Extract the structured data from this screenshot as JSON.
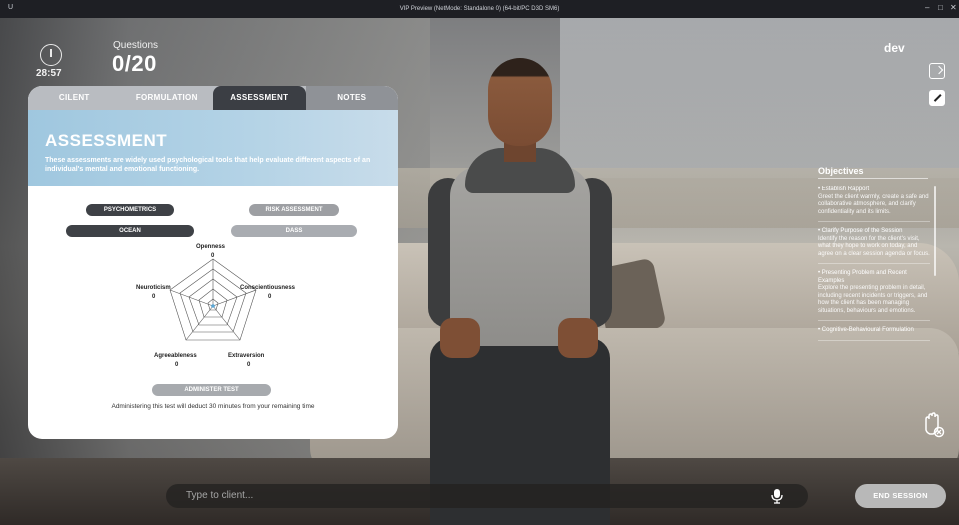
{
  "window": {
    "title": "VIP Preview (NetMode: Standalone 0) (64-bit/PC D3D SM6)",
    "app_icon": "U",
    "controls": [
      "–",
      "□",
      "✕"
    ]
  },
  "hud": {
    "timer": "28:57",
    "questions_label": "Questions",
    "questions_count": "0/20",
    "user": "dev"
  },
  "panel": {
    "tabs": [
      "CILENT",
      "FORMULATION",
      "ASSESSMENT",
      "NOTES"
    ],
    "active_tab": "ASSESSMENT",
    "title": "ASSESSMENT",
    "description": "These assessments are widely used psychological tools that help evaluate different aspects of an individual's mental and emotional functioning.",
    "categories": [
      "PSYCHOMETRICS",
      "RISK ASSESSMENT"
    ],
    "tests": [
      "OCEAN",
      "DASS"
    ],
    "radar": {
      "traits": [
        {
          "name": "Openness",
          "value": "0"
        },
        {
          "name": "Conscientiousness",
          "value": "0"
        },
        {
          "name": "Extraversion",
          "value": "0"
        },
        {
          "name": "Agreeableness",
          "value": "0"
        },
        {
          "name": "Neuroticism",
          "value": "0"
        }
      ]
    },
    "administer_button": "ADMINISTER TEST",
    "administer_note": "Administering this test will deduct 30 minutes from your remaining time"
  },
  "objectives": {
    "title": "Objectives",
    "items": [
      {
        "head": "• Establish Rapport",
        "body": "Greet the client warmly, create a safe and collaborative atmosphere, and clarify confidentiality and its limits."
      },
      {
        "head": "• Clarify Purpose of the Session",
        "body": "Identify the reason for the client's visit, what they hope to work on today, and agree on a clear session agenda or focus."
      },
      {
        "head": "• Presenting Problem and Recent Examples",
        "body": "Explore the presenting problem in detail, including recent incidents or triggers, and how the client has been managing situations, behaviours and emotions."
      },
      {
        "head": "• Cognitive-Behavioural Formulation",
        "body": ""
      }
    ]
  },
  "chat": {
    "placeholder": "Type to client...",
    "end_session": "END SESSION"
  }
}
